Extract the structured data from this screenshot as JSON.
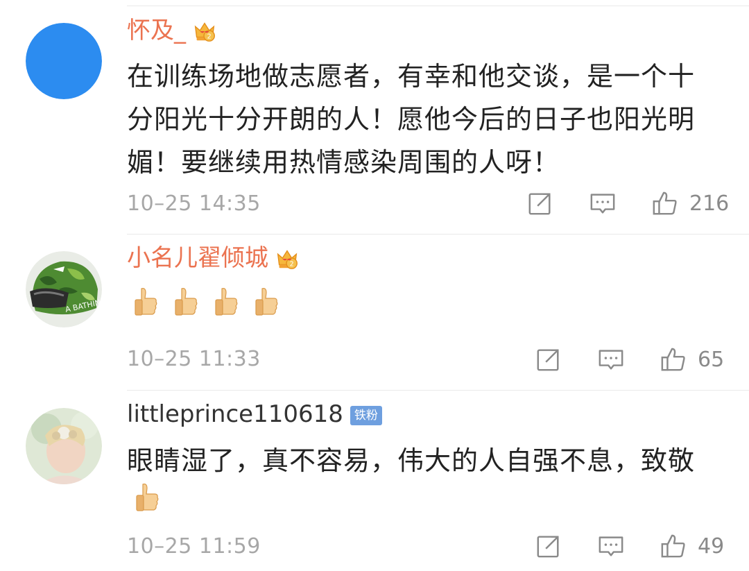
{
  "comments": [
    {
      "username": "怀及_",
      "badge": "vip-crown-icon",
      "text": "在训练场地做志愿者，有幸和他交谈，是一个十\n分阳光十分开朗的人！愿他今后的日子也阳光明\n媚！要继续用热情感染周围的人呀！",
      "time": "10–25 14:35",
      "likes": "216",
      "avatar_color": "#2c8cf0"
    },
    {
      "username": "小名儿翟倾城",
      "badge": "vip-crown-icon",
      "emojis": 4,
      "time": "10–25 11:33",
      "likes": "65"
    },
    {
      "username": "littleprince110618",
      "fan_badge": "铁粉",
      "text": "眼睛湿了，真不容易，伟大的人自强不息，致敬",
      "emojis": 1,
      "time": "10–25 11:59",
      "likes": "49"
    }
  ],
  "colors": {
    "username": "#eb7350",
    "fan_badge": "#6e9fdf",
    "timestamp": "#a7a7a7"
  },
  "icons": [
    "repost-icon",
    "comment-icon",
    "like-icon",
    "thumbs-up-emoji-icon"
  ]
}
